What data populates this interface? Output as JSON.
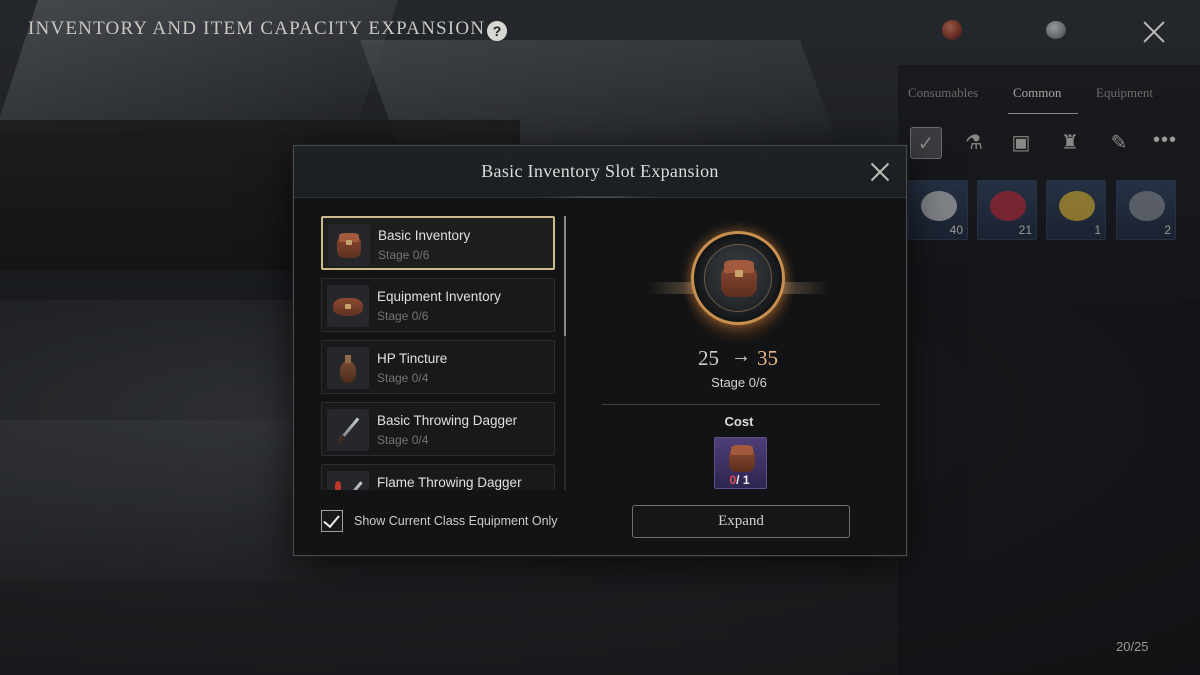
{
  "page": {
    "title": "INVENTORY AND ITEM CAPACITY EXPANSION",
    "help_glyph": "?"
  },
  "side_panel": {
    "tabs": [
      "Consumables",
      "Common",
      "Equipment"
    ],
    "active_tab": "Common",
    "more_glyph": "•••",
    "slots": [
      {
        "qty": "40",
        "color": "#d9d9d9"
      },
      {
        "qty": "21",
        "color": "#c0283a"
      },
      {
        "qty": "1",
        "color": "#e0b833"
      },
      {
        "qty": "2",
        "color": "#8f9398"
      }
    ],
    "capacity": "20/25"
  },
  "dialog": {
    "title": "Basic Inventory Slot Expansion",
    "list": [
      {
        "name": "Basic Inventory",
        "stage": "Stage 0/6",
        "icon": "pouch-icon",
        "selected": true
      },
      {
        "name": "Equipment Inventory",
        "stage": "Stage 0/6",
        "icon": "satchel-icon",
        "selected": false
      },
      {
        "name": "HP Tincture",
        "stage": "Stage 0/4",
        "icon": "flask-icon",
        "selected": false
      },
      {
        "name": "Basic Throwing Dagger",
        "stage": "Stage 0/4",
        "icon": "dagger-icon",
        "selected": false
      },
      {
        "name": "Flame Throwing Dagger",
        "stage": "",
        "icon": "flame-dagger-icon",
        "selected": false
      }
    ],
    "filter": {
      "label": "Show Current Class Equipment Only",
      "checked": true
    },
    "detail": {
      "from": "25",
      "arrow": "→",
      "to": "35",
      "stage": "Stage 0/6",
      "cost_label": "Cost",
      "cost_have": "0",
      "cost_need": "/ 1",
      "button": "Expand"
    }
  },
  "colors": {
    "selected_border": "#cdb98a",
    "accent_value": "#e3b987",
    "insufficient": "#e05050",
    "cost_slot": "#4e3e78"
  }
}
